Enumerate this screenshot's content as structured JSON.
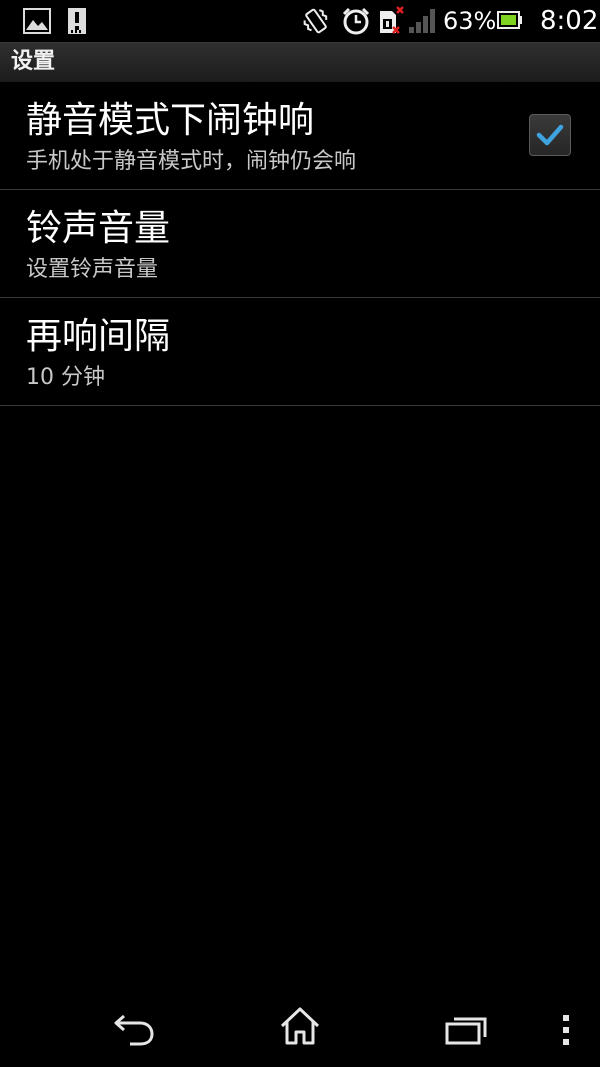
{
  "status_bar": {
    "battery_percent": "63%",
    "time": "8:02",
    "icons": [
      "gallery-icon",
      "sd-card-icon",
      "vibrate-icon",
      "alarm-icon",
      "no-sim-icon",
      "signal-icon",
      "battery-icon"
    ]
  },
  "header": {
    "title": "设置"
  },
  "preferences": [
    {
      "title": "静音模式下闹钟响",
      "summary": "手机处于静音模式时，闹钟仍会响",
      "checked": true
    },
    {
      "title": "铃声音量",
      "summary": "设置铃声音量"
    },
    {
      "title": "再响间隔",
      "summary": "10 分钟"
    }
  ],
  "nav_bar": {
    "buttons": [
      "back-icon",
      "home-icon",
      "recent-apps-icon",
      "menu-icon"
    ]
  },
  "colors": {
    "accent_check": "#3fa3e0",
    "background": "#000000",
    "divider": "#3a3a3a"
  }
}
